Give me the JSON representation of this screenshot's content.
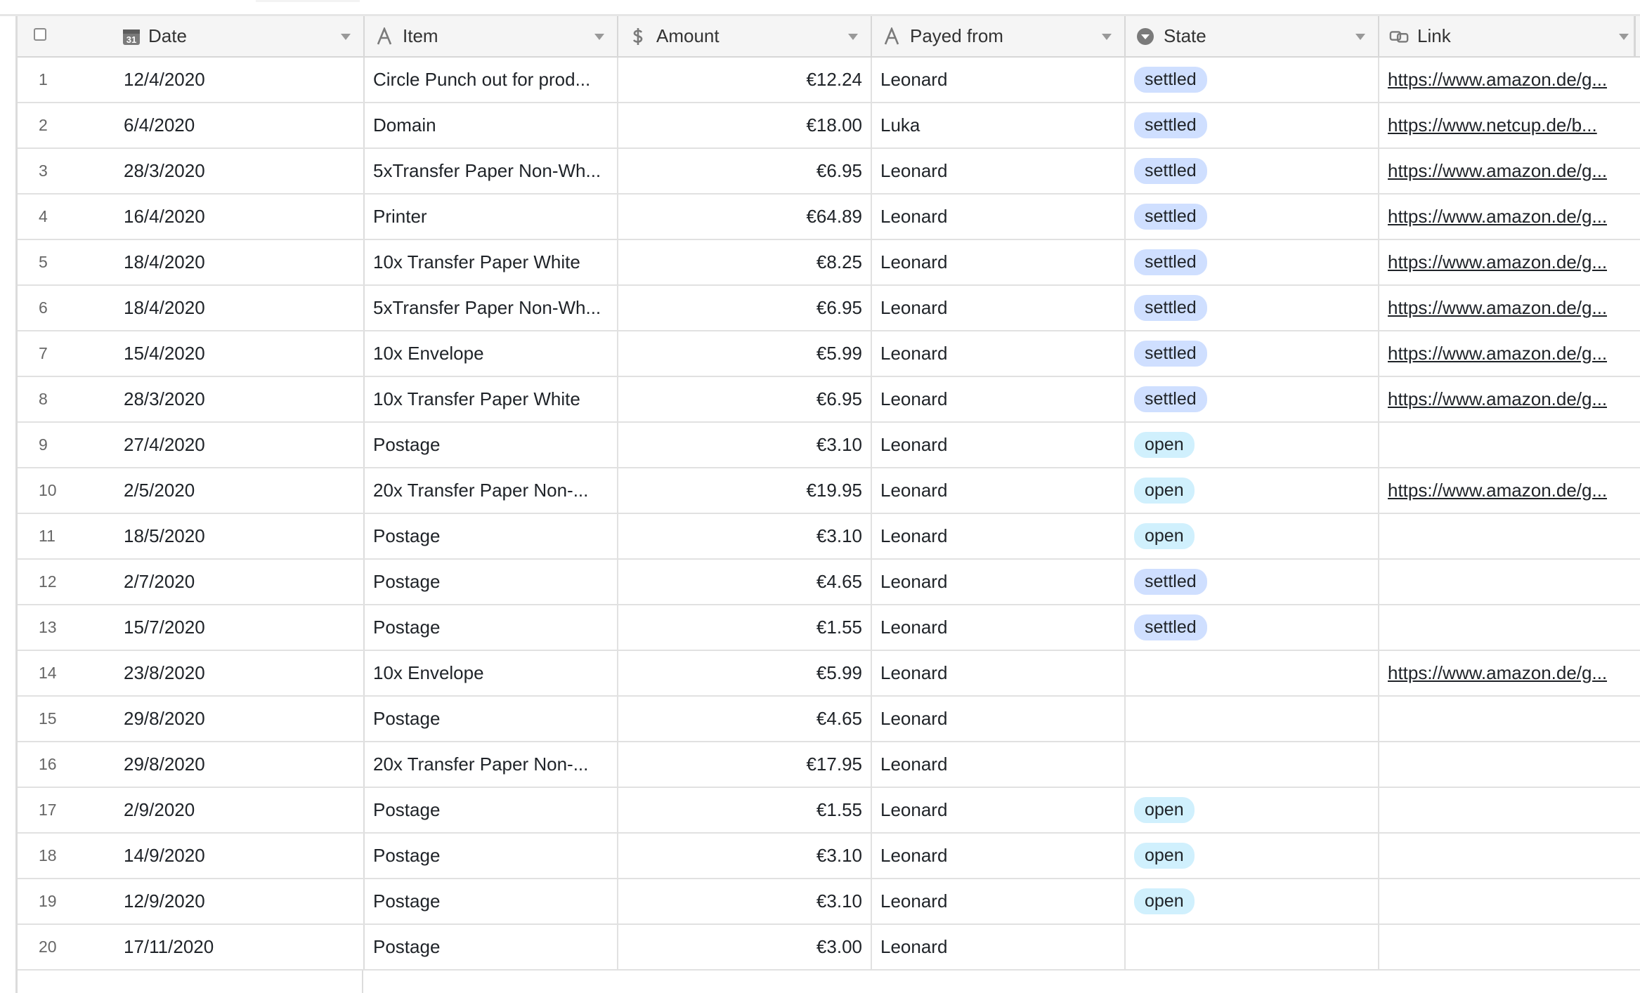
{
  "header": {
    "date_label": "Date",
    "item_label": "Item",
    "amount_label": "Amount",
    "payer_label": "Payed from",
    "state_label": "State",
    "link_label": "Link",
    "date_icon_text": "31"
  },
  "colors": {
    "settled_pill": "#cfdfff",
    "open_pill": "#d0f0fd"
  },
  "rows": [
    {
      "n": "1",
      "date": "12/4/2020",
      "item": "Circle Punch out for prod...",
      "amount": "€12.24",
      "payer": "Leonard",
      "state": "settled",
      "link": "https://www.amazon.de/g..."
    },
    {
      "n": "2",
      "date": "6/4/2020",
      "item": "Domain",
      "amount": "€18.00",
      "payer": "Luka",
      "state": "settled",
      "link": "https://www.netcup.de/b..."
    },
    {
      "n": "3",
      "date": "28/3/2020",
      "item": "5xTransfer Paper Non-Wh...",
      "amount": "€6.95",
      "payer": "Leonard",
      "state": "settled",
      "link": "https://www.amazon.de/g..."
    },
    {
      "n": "4",
      "date": "16/4/2020",
      "item": "Printer",
      "amount": "€64.89",
      "payer": "Leonard",
      "state": "settled",
      "link": "https://www.amazon.de/g..."
    },
    {
      "n": "5",
      "date": "18/4/2020",
      "item": "10x Transfer Paper White",
      "amount": "€8.25",
      "payer": "Leonard",
      "state": "settled",
      "link": "https://www.amazon.de/g..."
    },
    {
      "n": "6",
      "date": "18/4/2020",
      "item": "5xTransfer Paper Non-Wh...",
      "amount": "€6.95",
      "payer": "Leonard",
      "state": "settled",
      "link": "https://www.amazon.de/g..."
    },
    {
      "n": "7",
      "date": "15/4/2020",
      "item": "10x Envelope",
      "amount": "€5.99",
      "payer": "Leonard",
      "state": "settled",
      "link": "https://www.amazon.de/g..."
    },
    {
      "n": "8",
      "date": "28/3/2020",
      "item": "10x Transfer Paper White",
      "amount": "€6.95",
      "payer": "Leonard",
      "state": "settled",
      "link": "https://www.amazon.de/g..."
    },
    {
      "n": "9",
      "date": "27/4/2020",
      "item": "Postage",
      "amount": "€3.10",
      "payer": "Leonard",
      "state": "open",
      "link": ""
    },
    {
      "n": "10",
      "date": "2/5/2020",
      "item": "20x Transfer Paper Non-...",
      "amount": "€19.95",
      "payer": "Leonard",
      "state": "open",
      "link": "https://www.amazon.de/g..."
    },
    {
      "n": "11",
      "date": "18/5/2020",
      "item": "Postage",
      "amount": "€3.10",
      "payer": "Leonard",
      "state": "open",
      "link": ""
    },
    {
      "n": "12",
      "date": "2/7/2020",
      "item": "Postage",
      "amount": "€4.65",
      "payer": "Leonard",
      "state": "settled",
      "link": ""
    },
    {
      "n": "13",
      "date": "15/7/2020",
      "item": "Postage",
      "amount": "€1.55",
      "payer": "Leonard",
      "state": "settled",
      "link": ""
    },
    {
      "n": "14",
      "date": "23/8/2020",
      "item": "10x Envelope",
      "amount": "€5.99",
      "payer": "Leonard",
      "state": "",
      "link": "https://www.amazon.de/g..."
    },
    {
      "n": "15",
      "date": "29/8/2020",
      "item": "Postage",
      "amount": "€4.65",
      "payer": "Leonard",
      "state": "",
      "link": ""
    },
    {
      "n": "16",
      "date": "29/8/2020",
      "item": "20x Transfer Paper Non-...",
      "amount": "€17.95",
      "payer": "Leonard",
      "state": "",
      "link": ""
    },
    {
      "n": "17",
      "date": "2/9/2020",
      "item": "Postage",
      "amount": "€1.55",
      "payer": "Leonard",
      "state": "open",
      "link": ""
    },
    {
      "n": "18",
      "date": "14/9/2020",
      "item": "Postage",
      "amount": "€3.10",
      "payer": "Leonard",
      "state": "open",
      "link": ""
    },
    {
      "n": "19",
      "date": "12/9/2020",
      "item": "Postage",
      "amount": "€3.10",
      "payer": "Leonard",
      "state": "open",
      "link": ""
    },
    {
      "n": "20",
      "date": "17/11/2020",
      "item": "Postage",
      "amount": "€3.00",
      "payer": "Leonard",
      "state": "",
      "link": ""
    }
  ]
}
